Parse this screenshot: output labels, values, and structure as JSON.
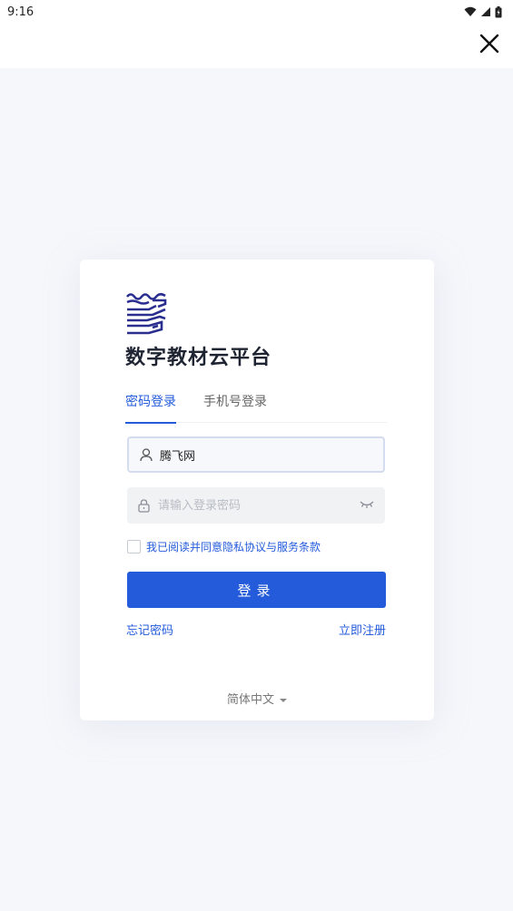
{
  "status_bar": {
    "time": "9:16"
  },
  "app": {
    "title": "数字教材云平台"
  },
  "tabs": [
    {
      "label": "密码登录",
      "active": true
    },
    {
      "label": "手机号登录",
      "active": false
    }
  ],
  "form": {
    "username_value": "腾飞网",
    "password_placeholder": "请输入登录密码",
    "agreement_text": "我已阅读并同意隐私协议与服务条款",
    "agreement_checked": false,
    "login_label": "登录",
    "forgot_label": "忘记密码",
    "register_label": "立即注册"
  },
  "language": {
    "selected": "简体中文"
  },
  "colors": {
    "accent": "#245bdb",
    "logo": "#2a2f8f",
    "title": "#1f2433"
  },
  "icons": {
    "close": "close-icon",
    "user": "user-icon",
    "lock": "lock-icon",
    "eye": "eye-closed-icon",
    "caret": "caret-down-icon"
  }
}
